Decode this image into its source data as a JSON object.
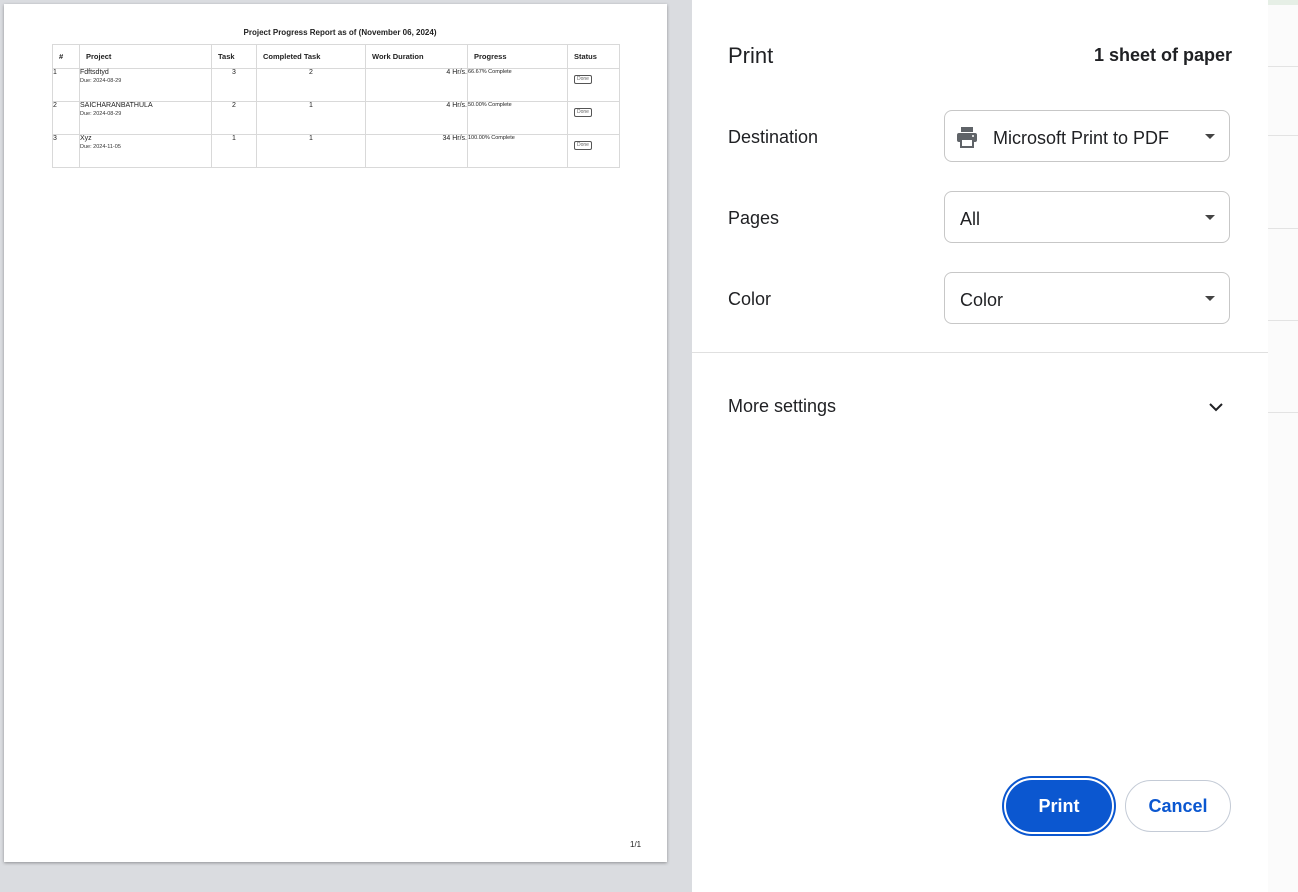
{
  "report": {
    "title": "Project Progress Report as of (November 06, 2024)",
    "columns": [
      "#",
      "Project",
      "Task",
      "Completed Task",
      "Work Duration",
      "Progress",
      "Status"
    ],
    "rows": [
      {
        "num": "1",
        "project": "Fdftsdtyd",
        "due": "Due: 2024-08-29",
        "task": "3",
        "completed": "2",
        "duration": "4 Hr/s.",
        "progress": "66.67% Complete",
        "status": "Done"
      },
      {
        "num": "2",
        "project": "SAICHARANBATHULA",
        "due": "Due: 2024-08-29",
        "task": "2",
        "completed": "1",
        "duration": "4 Hr/s.",
        "progress": "50.00% Complete",
        "status": "Done"
      },
      {
        "num": "3",
        "project": "Xyz",
        "due": "Due: 2024-11-05",
        "task": "1",
        "completed": "1",
        "duration": "34 Hr/s.",
        "progress": "100.00% Complete",
        "status": "Done"
      }
    ],
    "page_number": "1/1"
  },
  "panel": {
    "title": "Print",
    "sheet_count": "1 sheet of paper",
    "destination": {
      "label": "Destination",
      "value": "Microsoft Print to PDF",
      "icon": "printer-icon"
    },
    "pages": {
      "label": "Pages",
      "value": "All"
    },
    "color": {
      "label": "Color",
      "value": "Color"
    },
    "more_settings": {
      "label": "More settings",
      "icon": "chevron-down-icon"
    },
    "buttons": {
      "print": "Print",
      "cancel": "Cancel"
    }
  },
  "colors": {
    "accent": "#0b57d0",
    "preview_bg": "#dadce0"
  }
}
